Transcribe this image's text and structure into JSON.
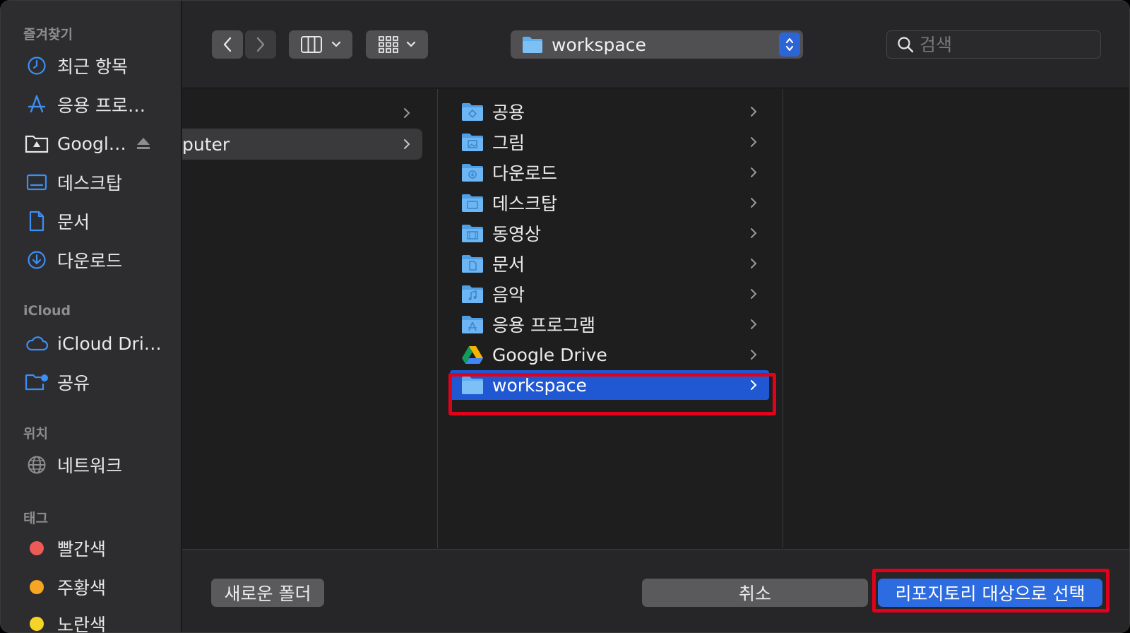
{
  "sidebar": {
    "favorites_heading": "즐겨찾기",
    "favorites": [
      {
        "label": "최근 항목",
        "icon": "clock-icon"
      },
      {
        "label": "응용 프로…",
        "icon": "app-store-icon"
      },
      {
        "label": "Googl…",
        "icon": "drive-folder-icon"
      },
      {
        "label": "데스크탑",
        "icon": "desktop-icon"
      },
      {
        "label": "문서",
        "icon": "document-icon"
      },
      {
        "label": "다운로드",
        "icon": "download-icon"
      }
    ],
    "icloud_heading": "iCloud",
    "icloud": [
      {
        "label": "iCloud Dri…",
        "icon": "cloud-icon"
      },
      {
        "label": "공유",
        "icon": "shared-folder-icon"
      }
    ],
    "locations_heading": "위치",
    "locations": [
      {
        "label": "네트워크",
        "icon": "globe-icon"
      }
    ],
    "tags_heading": "태그",
    "tags": [
      {
        "label": "빨간색",
        "color": "#ee5b57"
      },
      {
        "label": "주황색",
        "color": "#f5a623"
      },
      {
        "label": "노란색",
        "color": "#f5d327"
      }
    ]
  },
  "toolbar": {
    "path": "workspace",
    "search_placeholder": "검색"
  },
  "column1": {
    "items": [
      {
        "label": "",
        "selected": false
      },
      {
        "label": "puter",
        "selected": true
      }
    ]
  },
  "column2": {
    "items": [
      {
        "label": "공용",
        "icon": "public-folder-icon"
      },
      {
        "label": "그림",
        "icon": "pictures-folder-icon"
      },
      {
        "label": "다운로드",
        "icon": "downloads-folder-icon"
      },
      {
        "label": "데스크탑",
        "icon": "desktop-folder-icon"
      },
      {
        "label": "동영상",
        "icon": "movies-folder-icon"
      },
      {
        "label": "문서",
        "icon": "documents-folder-icon"
      },
      {
        "label": "음악",
        "icon": "music-folder-icon"
      },
      {
        "label": "응용 프로그램",
        "icon": "applications-folder-icon"
      },
      {
        "label": "Google Drive",
        "icon": "google-drive-icon"
      },
      {
        "label": "workspace",
        "icon": "folder-icon",
        "selected": true
      }
    ]
  },
  "footer": {
    "new_folder": "새로운 폴더",
    "cancel": "취소",
    "select": "리포지토리 대상으로 선택"
  },
  "colors": {
    "accent": "#2d6be0",
    "selection": "#2058d4",
    "annotation": "#e3001b"
  }
}
